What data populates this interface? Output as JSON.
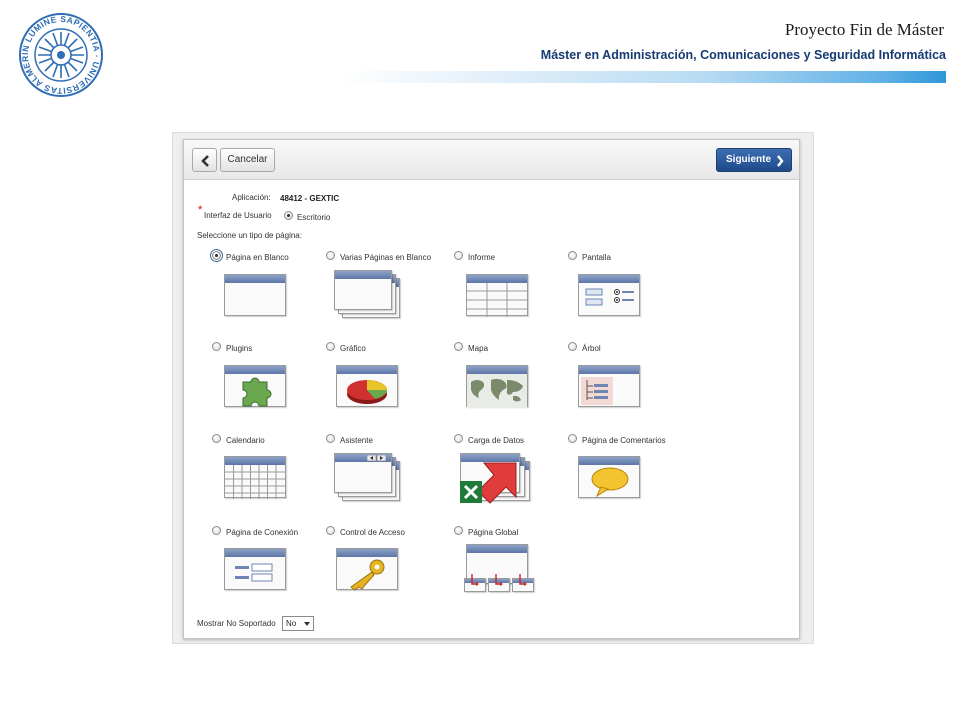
{
  "slide": {
    "title": "Proyecto Fin de Máster",
    "subtitle": "Máster en Administración, Comunicaciones y Seguridad Informática",
    "logo_text": "IN LUMINE SAPIENTIA · UNIVERSITAS ALMERIENSIS"
  },
  "toolbar": {
    "cancel_label": "Cancelar",
    "next_label": "Siguiente"
  },
  "form": {
    "application_label": "Aplicación:",
    "application_value": "48412 - GEXTIC",
    "required_mark": "*",
    "ui_label": "Interfaz de Usuario",
    "ui_option": "Escritorio",
    "page_type_label": "Seleccione un tipo de página:",
    "page_types": [
      {
        "label": "Página en Blanco",
        "selected": true
      },
      {
        "label": "Varias Páginas en Blanco",
        "selected": false
      },
      {
        "label": "Informe",
        "selected": false
      },
      {
        "label": "Pantalla",
        "selected": false
      },
      {
        "label": "Plugins",
        "selected": false
      },
      {
        "label": "Gráfico",
        "selected": false
      },
      {
        "label": "Mapa",
        "selected": false
      },
      {
        "label": "Árbol",
        "selected": false
      },
      {
        "label": "Calendario",
        "selected": false
      },
      {
        "label": "Asistente",
        "selected": false
      },
      {
        "label": "Carga de Datos",
        "selected": false
      },
      {
        "label": "Página de Comentarios",
        "selected": false
      },
      {
        "label": "Página de Conexión",
        "selected": false
      },
      {
        "label": "Control de Acceso",
        "selected": false
      },
      {
        "label": "Página Global",
        "selected": false
      }
    ],
    "show_unsupported_label": "Mostrar No Soportado",
    "show_unsupported_value": "No"
  },
  "colors": {
    "brand_blue": "#163b72",
    "next_button": "#2a5a9e",
    "window_bar": "#6f86b4"
  }
}
